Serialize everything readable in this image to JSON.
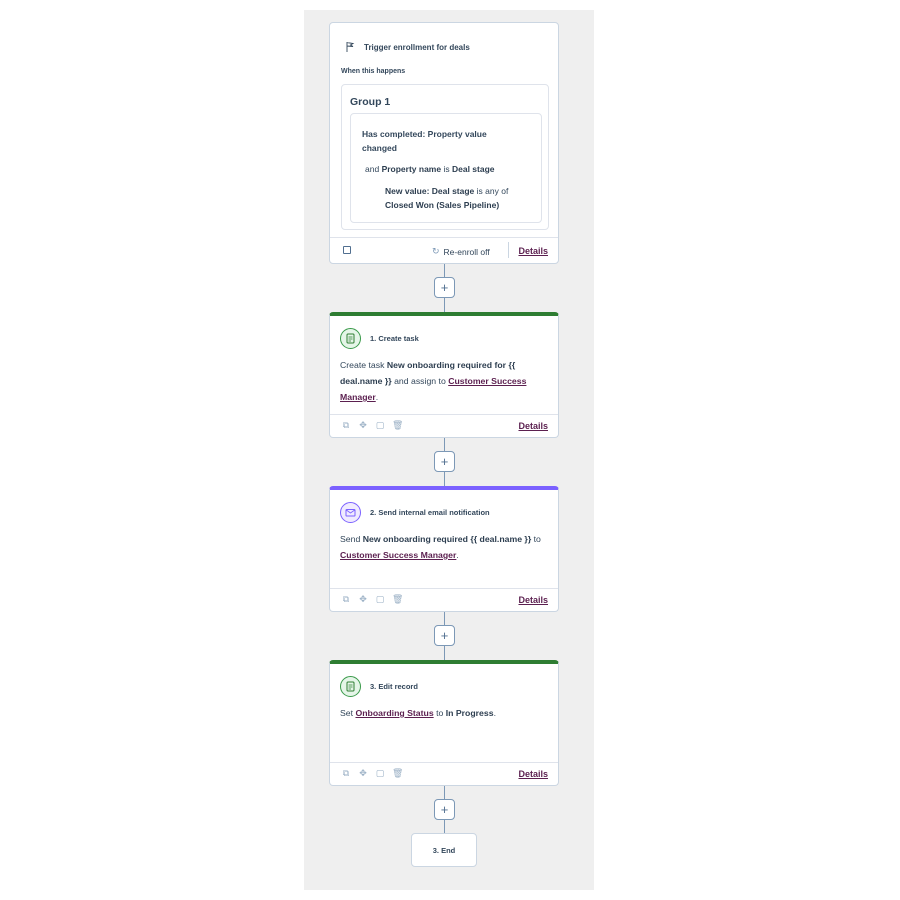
{
  "trigger": {
    "title": "Trigger enrollment for deals",
    "when_label": "When this happens",
    "group_title": "Group 1",
    "condition_1": "Has completed: Property value changed",
    "condition_2_prefix": "and",
    "condition_2_property_label": "Property name",
    "condition_2_is": "is",
    "condition_2_value": "Deal stage",
    "condition_3_label": "New value: Deal stage",
    "condition_3_mid": "is any of",
    "condition_3_value": "Closed Won (Sales Pipeline)",
    "reenroll": "Re-enroll off",
    "details": "Details"
  },
  "steps": [
    {
      "title": "1. Create task",
      "body_1": "Create task",
      "body_bold": "New onboarding required for {{ deal.name }}",
      "body_2": "and assign to",
      "body_link": "Customer Success Manager",
      "body_end": ".",
      "details": "Details",
      "accent": "#2e7d32",
      "icon": "task-icon"
    },
    {
      "title": "2. Send internal email notification",
      "body_1": "Send",
      "body_bold": "New onboarding required {{ deal.name }}",
      "body_2": "to",
      "body_link": "Customer Success Manager",
      "body_end": ".",
      "details": "Details",
      "accent": "#7b61ff",
      "icon": "email-icon"
    },
    {
      "title": "3. Edit record",
      "body_1": "Set",
      "body_link": "Onboarding Status",
      "body_2": "to",
      "body_bold": "In Progress",
      "body_end": ".",
      "details": "Details",
      "accent": "#2e7d32",
      "icon": "record-icon"
    }
  ],
  "add_button": "+",
  "end_label": "3. End",
  "colors": {
    "link": "#5b1f4f",
    "canvas": "#efefef",
    "green_accent": "#2e7d32",
    "purple_accent": "#7b61ff"
  }
}
